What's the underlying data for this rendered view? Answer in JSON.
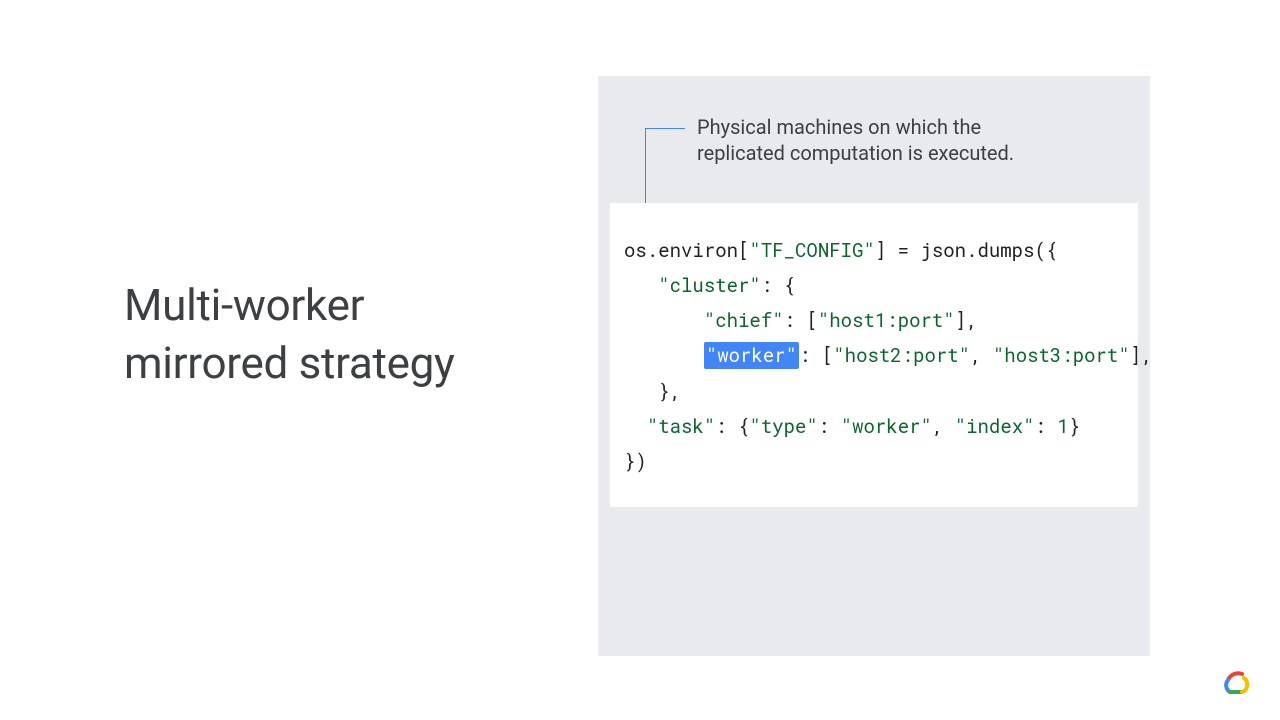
{
  "title_line1": "Multi-worker",
  "title_line2": "mirrored strategy",
  "annotation": "Physical machines on which the replicated computation is executed.",
  "code": {
    "l1_a": "os.environ[",
    "l1_b": "\"TF_CONFIG\"",
    "l1_c": "] = json.dumps({",
    "l2_a": "   ",
    "l2_b": "\"cluster\"",
    "l2_c": ": {",
    "l3_a": "       ",
    "l3_b": "\"chief\"",
    "l3_c": ": [",
    "l3_d": "\"host1:port\"",
    "l3_e": "],",
    "l4_a": "       ",
    "l4_hl": "\"worker\"",
    "l4_c": ": [",
    "l4_d": "\"host2:port\"",
    "l4_e": ", ",
    "l4_f": "\"host3:port\"",
    "l4_g": "],",
    "l5": "   },",
    "l6_a": "  ",
    "l6_b": "\"task\"",
    "l6_c": ": {",
    "l6_d": "\"type\"",
    "l6_e": ": ",
    "l6_f": "\"worker\"",
    "l6_g": ", ",
    "l6_h": "\"index\"",
    "l6_i": ": ",
    "l6_j": "1",
    "l6_k": "}",
    "l7": "})"
  }
}
